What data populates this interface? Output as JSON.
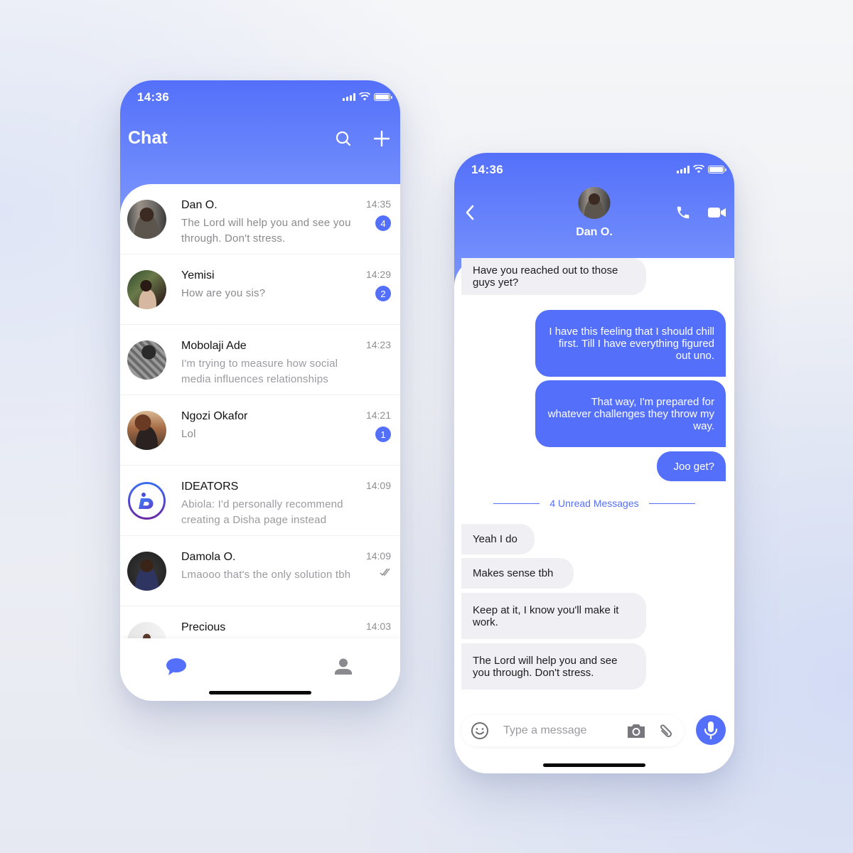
{
  "colors": {
    "accent": "#5470fa",
    "header_gradient_top": "#5470fa",
    "header_gradient_bottom": "#7b96fc",
    "incoming_bubble": "#efeff4",
    "outgoing_bubble": "#5470fa",
    "muted_text": "#8a8a8e"
  },
  "list_screen": {
    "status_time": "14:36",
    "title": "Chat",
    "header_icons": [
      "search-icon",
      "plus-icon"
    ],
    "chats": [
      {
        "name": "Dan O.",
        "preview": "The Lord will help you and see you through. Don't stress.",
        "time": "14:35",
        "unread": "4",
        "avatar": "photo"
      },
      {
        "name": "Yemisi",
        "preview": "How are you sis?",
        "time": "14:29",
        "unread": "2",
        "avatar": "photo"
      },
      {
        "name": "Mobolaji Ade",
        "preview": "I'm trying to measure how social media influences relationships",
        "time": "14:23",
        "unread": null,
        "avatar": "photo"
      },
      {
        "name": "Ngozi Okafor",
        "preview": "Lol",
        "time": "14:21",
        "unread": "1",
        "avatar": "photo"
      },
      {
        "name": "IDEATORS",
        "preview": "Abiola: I'd personally recommend creating a Disha page instead",
        "time": "14:09",
        "unread": null,
        "avatar": "ideators-logo"
      },
      {
        "name": "Damola O.",
        "preview": "Lmaooo that's the only solution tbh",
        "time": "14:09",
        "unread": null,
        "status": "read-double-check-icon",
        "avatar": "photo"
      },
      {
        "name": "Precious",
        "preview": "",
        "time": "14:03",
        "unread": null,
        "avatar": "photo"
      }
    ],
    "tabs": [
      {
        "name": "chats",
        "icon": "chat-bubble-icon",
        "active": true
      },
      {
        "name": "profile",
        "icon": "user-icon",
        "active": false
      }
    ]
  },
  "chat_screen": {
    "status_time": "14:36",
    "contact_name": "Dan O.",
    "header_icons": [
      "back-icon",
      "phone-icon",
      "video-icon"
    ],
    "messages": [
      {
        "direction": "in",
        "text": "Have you reached out to those guys yet?"
      },
      {
        "direction": "out",
        "text": "I have this feeling that I should chill first. Till I have everything figured out uno."
      },
      {
        "direction": "out",
        "text": "That way, I'm prepared for whatever challenges they throw my way."
      },
      {
        "direction": "out",
        "text": "Joo get?"
      },
      {
        "direction": "in",
        "text": "Yeah I do"
      },
      {
        "direction": "in",
        "text": "Makes sense tbh"
      },
      {
        "direction": "in",
        "text": "Keep at it, I know you'll make it work."
      },
      {
        "direction": "in",
        "text": "The Lord will help you and see you through. Don't stress."
      }
    ],
    "unread_divider": "4 Unread Messages",
    "composer": {
      "placeholder": "Type a message",
      "value": "",
      "icons": [
        "emoji-icon",
        "camera-icon",
        "paperclip-icon",
        "microphone-icon"
      ]
    }
  }
}
